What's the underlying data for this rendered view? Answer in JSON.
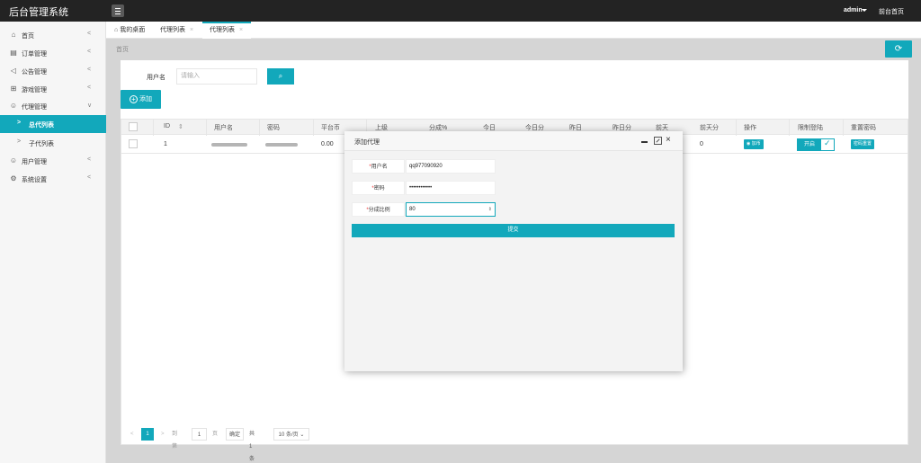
{
  "app": {
    "title": "后台管理系统"
  },
  "header": {
    "user": "admin",
    "front_link": "前台首页"
  },
  "sidebar": {
    "items": [
      {
        "label": "首页",
        "icon": "home-icon"
      },
      {
        "label": "订单管理",
        "icon": "order-icon"
      },
      {
        "label": "公告管理",
        "icon": "announce-icon"
      },
      {
        "label": "游戏管理",
        "icon": "game-icon"
      },
      {
        "label": "代理管理",
        "icon": "agent-icon"
      },
      {
        "label": "总代列表",
        "icon": "chevron-right-icon"
      },
      {
        "label": "子代列表",
        "icon": "chevron-right-icon"
      },
      {
        "label": "用户管理",
        "icon": "user-icon"
      },
      {
        "label": "系统设置",
        "icon": "settings-icon"
      }
    ]
  },
  "tabs": [
    {
      "label": "我的桌面"
    },
    {
      "label": "代理列表"
    },
    {
      "label": "代理列表"
    }
  ],
  "breadcrumb": "首页",
  "search": {
    "label": "用户名",
    "placeholder": "请输入"
  },
  "toolbar": {
    "add_label": "添加"
  },
  "table": {
    "headers": [
      "ID",
      "用户名",
      "密码",
      "平台币",
      "上级",
      "分成%",
      "今日",
      "今日分",
      "昨日",
      "昨日分",
      "前天",
      "前天分",
      "操作",
      "限制登陆",
      "重置密码"
    ],
    "rows": [
      {
        "id": "1",
        "platform_coin": "0.00",
        "day_before": "0",
        "action": "加币",
        "login_toggle": "开启",
        "reset": "密码重置"
      }
    ]
  },
  "pagination": {
    "current": "1",
    "goto_label": "到第",
    "goto_value": "1",
    "page_unit": "页",
    "confirm": "确定",
    "total": "共 1 条",
    "page_size": "10 条/页"
  },
  "dialog": {
    "title": "添加代理",
    "fields": [
      {
        "label": "用户名",
        "value": "qq977090920"
      },
      {
        "label": "密码",
        "value": "••••••••••••"
      },
      {
        "label": "分成比例",
        "value": "80"
      }
    ],
    "submit": "提交"
  },
  "colors": {
    "accent": "#12a8bb",
    "topbar": "#232323"
  }
}
